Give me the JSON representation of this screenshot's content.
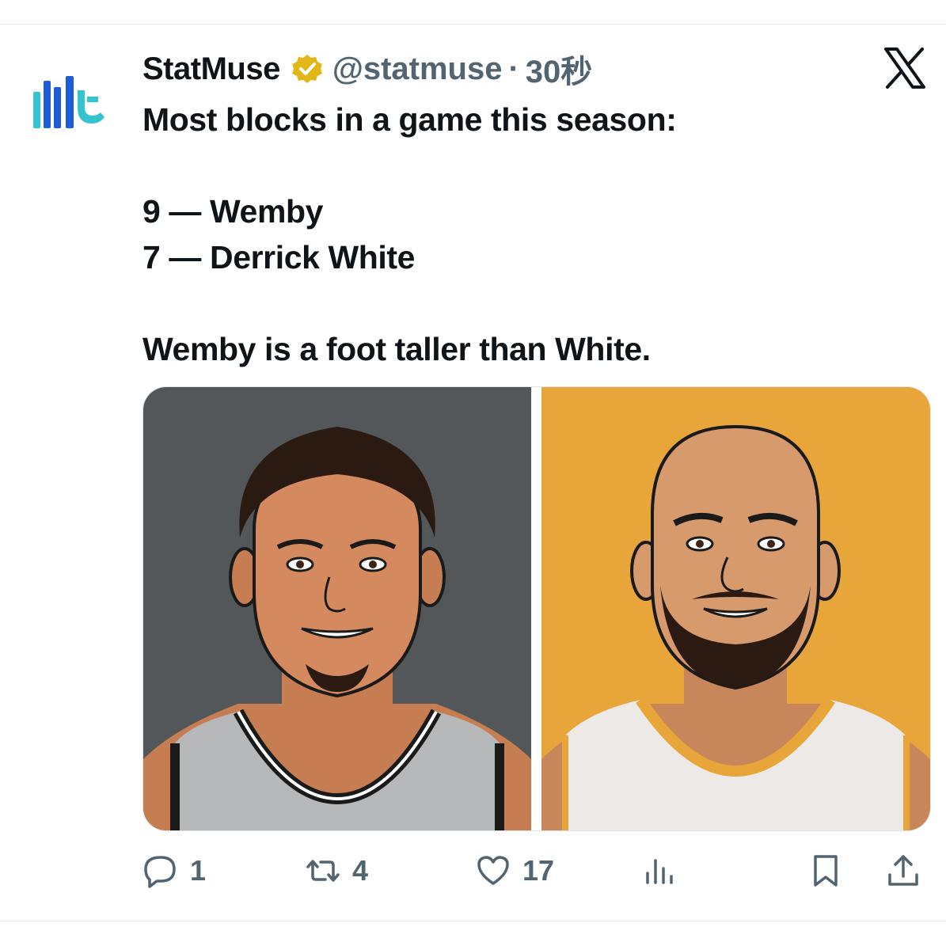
{
  "tweet": {
    "author": {
      "name": "StatMuse",
      "handle": "@statmuse",
      "verified_icon": "verified-badge-icon",
      "avatar_icon": "statmuse-logo-icon"
    },
    "separator": "·",
    "timestamp": "30秒",
    "close_icon": "x-logo-icon",
    "text_lines": [
      "Most blocks in a game this season:",
      "",
      "9 — Wemby",
      "7 — Derrick White",
      "",
      "Wemby is a foot taller than White."
    ],
    "media": {
      "left_image": {
        "subject": "player-illustration-wemby",
        "background": "#545759"
      },
      "right_image": {
        "subject": "player-illustration-derrick-white",
        "background": "#e8a53a"
      }
    },
    "actions": {
      "reply": {
        "icon": "reply-icon",
        "count": "1"
      },
      "repost": {
        "icon": "repost-icon",
        "count": "4"
      },
      "like": {
        "icon": "heart-icon",
        "count": "17"
      },
      "views": {
        "icon": "analytics-icon",
        "count": ""
      },
      "bookmark": {
        "icon": "bookmark-icon"
      },
      "share": {
        "icon": "share-icon"
      }
    }
  },
  "colors": {
    "text_primary": "#0f1419",
    "text_secondary": "#536471",
    "verified_gold": "#e2b719",
    "brand_teal": "#35c3d0",
    "brand_blue": "#1e5bd6"
  }
}
